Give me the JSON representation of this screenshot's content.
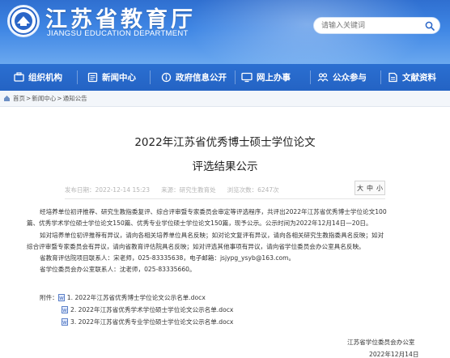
{
  "header": {
    "title": "江苏省教育厅",
    "subtitle": "JIANGSU EDUCATION DEPARTMENT",
    "search_placeholder": "请输入关键词"
  },
  "nav": {
    "items": [
      {
        "label": "组织机构",
        "icon": "org-icon"
      },
      {
        "label": "新闻中心",
        "icon": "news-icon"
      },
      {
        "label": "政府信息公开",
        "icon": "gov-info-icon"
      },
      {
        "label": "网上办事",
        "icon": "online-service-icon"
      },
      {
        "label": "公众参与",
        "icon": "public-participation-icon"
      },
      {
        "label": "文献资料",
        "icon": "documents-icon"
      }
    ]
  },
  "breadcrumb": {
    "items": [
      "首页",
      "新闻中心",
      "通知公告"
    ],
    "separator": ">"
  },
  "article": {
    "title_line1": "2022年江苏省优秀博士硕士学位论文",
    "title_line2": "评选结果公示",
    "meta": {
      "published": "发布日期：2022-12-14 15:23",
      "source": "来源：研究生教育处",
      "views": "浏览次数：6247次"
    },
    "font_size_controls": [
      "大",
      "中",
      "小"
    ],
    "paragraphs": [
      "经培养单位初评推荐、研究生教指委复评、综合评审暨专家委员会审定等评选程序，共评出2022年江苏省优秀博士学位论文100",
      "篇、优秀学术学位硕士学位论文150篇、优秀专业学位硕士学位论文150篇，现予公示。公示时间为2022年12月14日—20日。",
      "如对培养单位初评推荐有异议，请向各相关培养单位具名反映；如对论文复评有异议，请向各相关研究生教指委具名反映；如对",
      "综合评审暨专家委员会有异议，请向省教育评估院具名反映；如对评选其他事项有异议，请向省学位委员会办公室具名反映。",
      "省教育评估院项目联系人：宋老师，025-83335638，电子邮箱：jsjypg_ysyb@163.com。",
      "省学位委员会办公室联系人：沈老师，025-83335660。"
    ],
    "attachments_label": "附件：",
    "attachments": [
      "1. 2022年江苏省优秀博士学位论文公示名单.docx",
      "2. 2022年江苏省优秀学术学位硕士学位论文公示名单.docx",
      "3. 2022年江苏省优秀专业学位硕士学位论文公示名单.docx"
    ],
    "signature": "江苏省学位委员会办公室",
    "date": "2022年12月14日"
  },
  "colors": {
    "nav_bg": "#2463c4",
    "header_top": "#2f6fd0",
    "header_bottom": "#6aa8ef",
    "meta_text": "#b5b5b5"
  }
}
